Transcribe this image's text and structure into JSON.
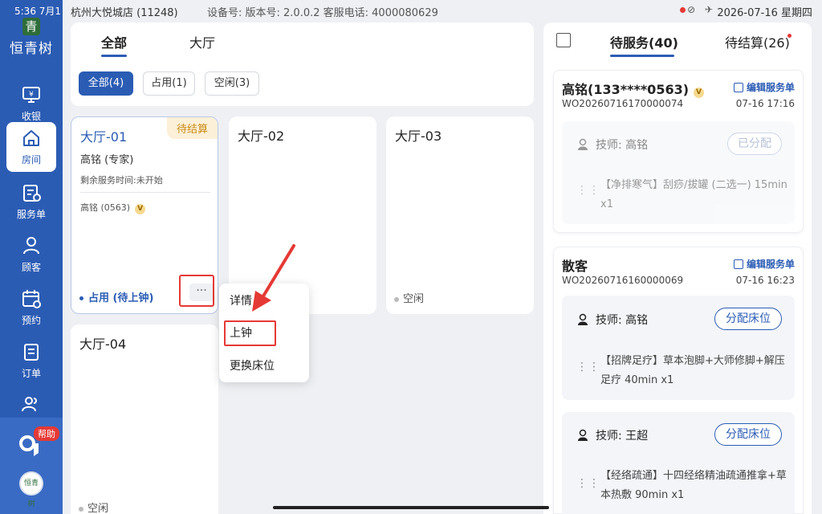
{
  "status_bar": {
    "time": "5:36 7月1",
    "shop": "杭州大悦城店  (11248)",
    "device": "设备号: 版本号: 2.0.0.2  客服电话: 4000080629",
    "datetime": "2026-07-16 星期四"
  },
  "brand": {
    "logo_mark": "青",
    "name": "恒青树",
    "avatar_text": "恒青树"
  },
  "sidebar": {
    "items": [
      {
        "label": "收银",
        "icon": "cashier-icon"
      },
      {
        "label": "房间",
        "icon": "home-icon"
      },
      {
        "label": "服务单",
        "icon": "service-order-icon"
      },
      {
        "label": "顾客",
        "icon": "customer-icon"
      },
      {
        "label": "预约",
        "icon": "calendar-icon"
      },
      {
        "label": "订单",
        "icon": "order-icon"
      },
      {
        "label": "",
        "icon": "staff-icon"
      }
    ],
    "help_badge": "帮助"
  },
  "top_tabs": {
    "all": "全部",
    "hall": "大厅"
  },
  "filters": {
    "all": "全部(4)",
    "occupied": "占用(1)",
    "free": "空闲(3)"
  },
  "rooms": [
    {
      "title": "大厅-01",
      "tag": "待结算",
      "tech": "高铭 (专家)",
      "remaining": "剩余服务时间:未开始",
      "customer": "高铭 (0563)",
      "vip": "V",
      "status": "占用 (待上钟)",
      "more": "···"
    },
    {
      "title": "大厅-02"
    },
    {
      "title": "大厅-03",
      "status": "空闲"
    },
    {
      "title": "大厅-04",
      "status": "空闲"
    }
  ],
  "popup_menu": {
    "items": [
      "详情",
      "上钟",
      "更换床位"
    ]
  },
  "right_panel": {
    "tabs": {
      "pending_service": "待服务(40)",
      "pending_checkout": "待结算(26)"
    },
    "orders": [
      {
        "name": "高铭(133****0563)",
        "vip": "V",
        "edit_label": "编辑服务单",
        "order_no": "WO20260716170000074",
        "time": "07-16 17:16",
        "services": [
          {
            "tech_label": "技师: 高铭",
            "button": "已分配",
            "text": "【净排寒气】刮痧/拔罐 (二选一) 15min x1",
            "assigned": true
          }
        ]
      },
      {
        "name": "散客",
        "edit_label": "编辑服务单",
        "order_no": "WO20260716160000069",
        "time": "07-16 16:23",
        "services": [
          {
            "tech_label": "技师: 高铭",
            "button": "分配床位",
            "text": "【招牌足疗】草本泡脚+大师修脚+解压足疗 40min x1",
            "assigned": false
          },
          {
            "tech_label": "技师: 王超",
            "button": "分配床位",
            "text": "【经络疏通】十四经络精油疏通推拿+草本热敷 90min x1",
            "assigned": false
          }
        ]
      }
    ]
  },
  "colors": {
    "primary": "#2b5cb4",
    "accent_red": "#e53935",
    "pending_tag": "#c88a16"
  }
}
